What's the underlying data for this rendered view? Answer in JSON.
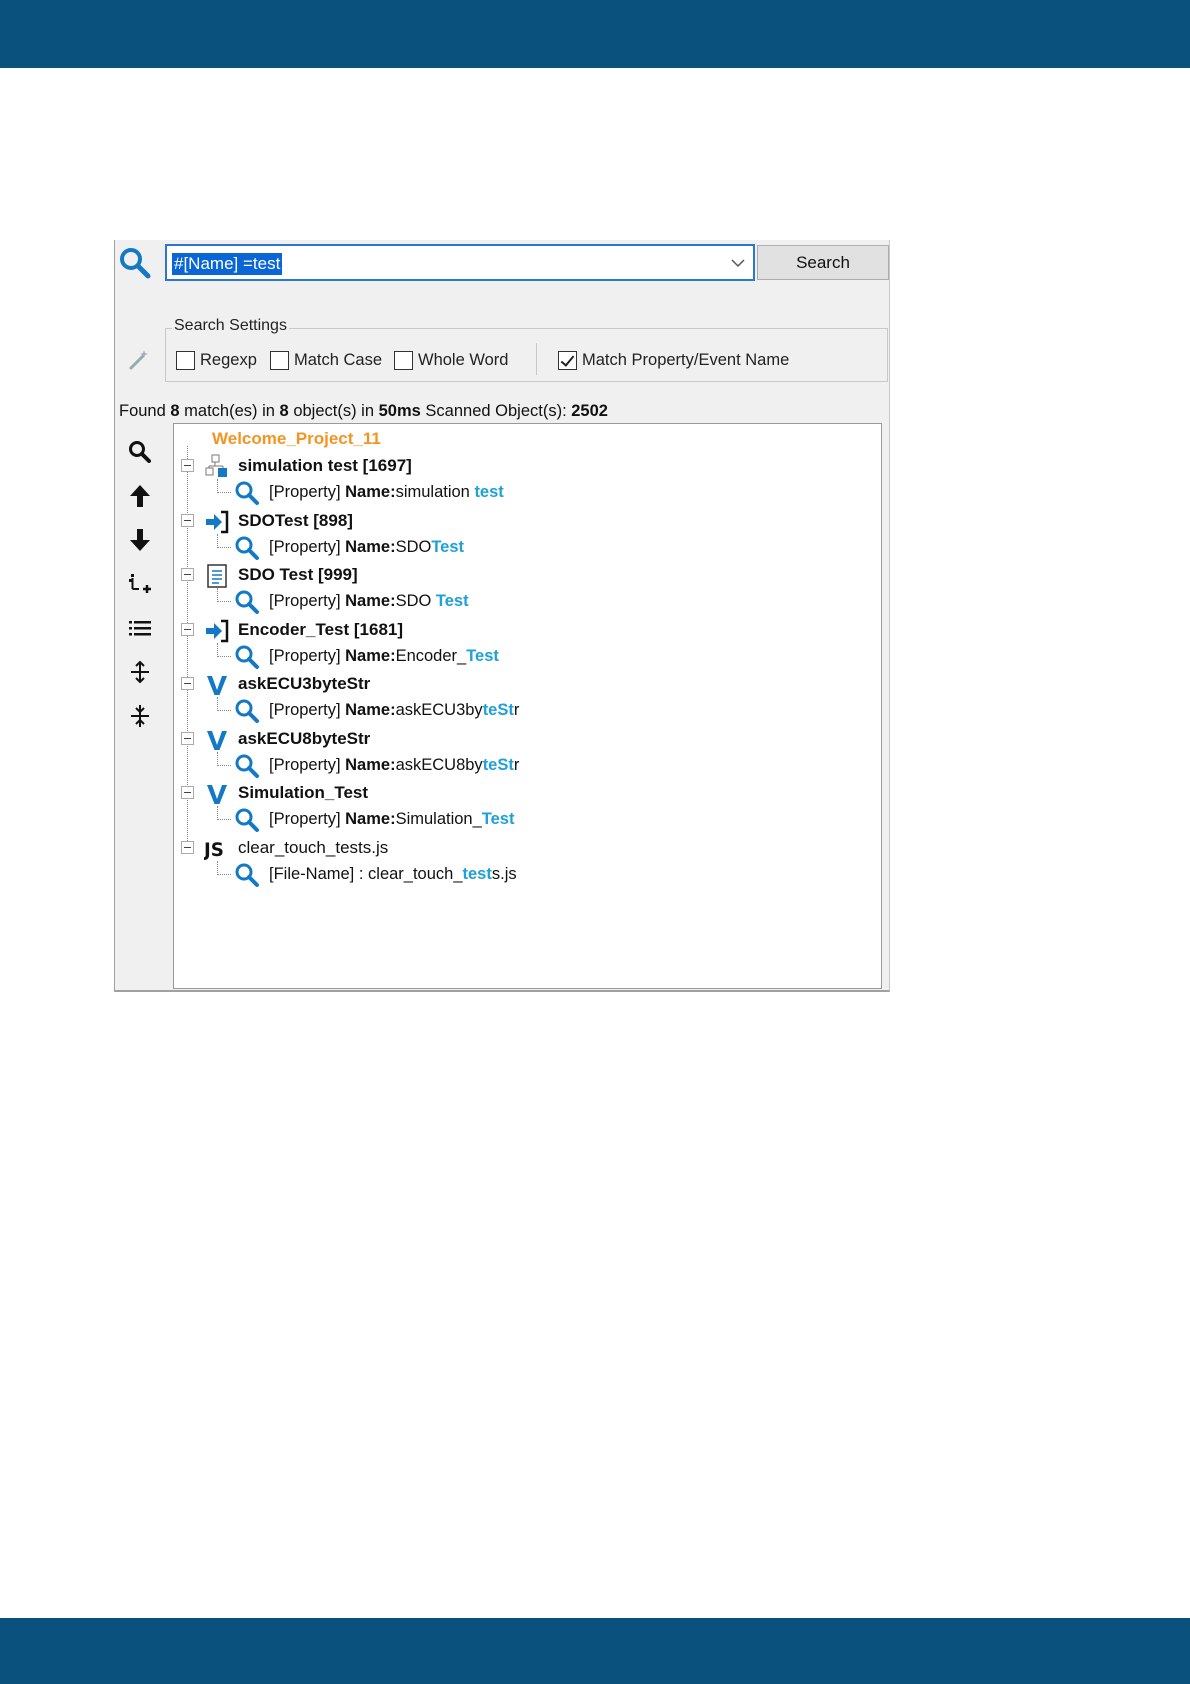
{
  "search": {
    "query": "#[Name] =test",
    "button_label": "Search"
  },
  "settings": {
    "legend": "Search Settings",
    "regexp_label": "Regexp",
    "regexp_checked": false,
    "match_case_label": "Match Case",
    "match_case_checked": false,
    "whole_word_label": "Whole Word",
    "whole_word_checked": false,
    "match_property_label": "Match Property/Event Name",
    "match_property_checked": true
  },
  "status": {
    "found_label": "Found",
    "matches": "8",
    "matches_suffix": "match(es) in",
    "objects": "8",
    "objects_suffix": "object(s) in",
    "time": "50ms",
    "scanned_label": "Scanned Object(s):",
    "scanned": "2502"
  },
  "toolbar": {
    "icons": [
      "search-icon",
      "arrow-up-icon",
      "arrow-down-icon",
      "add-node-icon",
      "list-icon",
      "expand-all-icon",
      "collapse-all-icon"
    ]
  },
  "tree": {
    "root": "Welcome_Project_11",
    "nodes": [
      {
        "icon": "flowchart-icon",
        "label": "simulation test [1697]",
        "bold": true,
        "match_prefix": "[Property]",
        "match_key": "Name:",
        "match_pre": "simulation ",
        "match_hl": "test",
        "match_post": ""
      },
      {
        "icon": "arrow-in-icon",
        "label": "SDOTest [898]",
        "bold": true,
        "match_prefix": "[Property]",
        "match_key": "Name:",
        "match_pre": "SDO",
        "match_hl": "Test",
        "match_post": ""
      },
      {
        "icon": "document-icon",
        "label": "SDO Test [999]",
        "bold": true,
        "match_prefix": "[Property]",
        "match_key": "Name:",
        "match_pre": "SDO ",
        "match_hl": "Test",
        "match_post": ""
      },
      {
        "icon": "arrow-in-icon",
        "label": "Encoder_Test [1681]",
        "bold": true,
        "match_prefix": "[Property]",
        "match_key": "Name:",
        "match_pre": "Encoder_",
        "match_hl": "Test",
        "match_post": ""
      },
      {
        "icon": "variable-icon",
        "label": "askECU3byteStr",
        "bold": true,
        "match_prefix": "[Property]",
        "match_key": "Name:",
        "match_pre": "askECU3by",
        "match_hl": "teSt",
        "match_post": "r"
      },
      {
        "icon": "variable-icon",
        "label": "askECU8byteStr",
        "bold": true,
        "match_prefix": "[Property]",
        "match_key": "Name:",
        "match_pre": "askECU8by",
        "match_hl": "teSt",
        "match_post": "r"
      },
      {
        "icon": "variable-icon",
        "label": "Simulation_Test",
        "bold": true,
        "match_prefix": "[Property]",
        "match_key": "Name:",
        "match_pre": "Simulation_",
        "match_hl": "Test",
        "match_post": ""
      },
      {
        "icon": "javascript-icon",
        "label": "clear_touch_tests.js",
        "bold": false,
        "match_prefix": "[File-Name] :",
        "match_key": "",
        "match_pre": "clear_touch_",
        "match_hl": "test",
        "match_post": "s.js"
      }
    ]
  },
  "colors": {
    "brand_bar": "#0a517e",
    "root_orange": "#f59421",
    "highlight": "#1fa0d8",
    "icon_blue": "#1479c4"
  }
}
